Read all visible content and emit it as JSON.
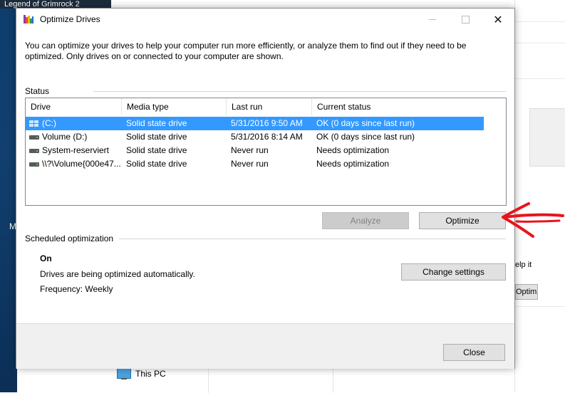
{
  "background": {
    "desktop_title": "Legend of Grimrock 2",
    "desktop_letter": "M",
    "right_peek_text": "elp it",
    "right_peek_button": "Optimiz",
    "explorer_item": "This PC"
  },
  "dialog": {
    "title": "Optimize Drives",
    "intro": "You can optimize your drives to help your computer run more efficiently, or analyze them to find out if they need to be optimized. Only drives on or connected to your computer are shown.",
    "status_label": "Status",
    "columns": [
      "Drive",
      "Media type",
      "Last run",
      "Current status"
    ],
    "drives": [
      {
        "drive": "(C:)",
        "media": "Solid state drive",
        "last_run": "5/31/2016 9:50 AM",
        "status": "OK (0 days since last run)",
        "icon": "windows-drive-icon",
        "selected": true
      },
      {
        "drive": "Volume (D:)",
        "media": "Solid state drive",
        "last_run": "5/31/2016 8:14 AM",
        "status": "OK (0 days since last run)",
        "icon": "hard-drive-icon",
        "selected": false
      },
      {
        "drive": "System-reserviert",
        "media": "Solid state drive",
        "last_run": "Never run",
        "status": "Needs optimization",
        "icon": "hard-drive-icon",
        "selected": false
      },
      {
        "drive": "\\\\?\\Volume{000e47...",
        "media": "Solid state drive",
        "last_run": "Never run",
        "status": "Needs optimization",
        "icon": "hard-drive-icon",
        "selected": false
      }
    ],
    "analyze_label": "Analyze",
    "optimize_label": "Optimize",
    "scheduled_label": "Scheduled optimization",
    "schedule_state": "On",
    "schedule_desc": "Drives are being optimized automatically.",
    "schedule_freq": "Frequency: Weekly",
    "change_settings_label": "Change settings",
    "close_label": "Close"
  },
  "colors": {
    "selection": "#3399ff",
    "annotation_arrow": "#e8141b"
  }
}
